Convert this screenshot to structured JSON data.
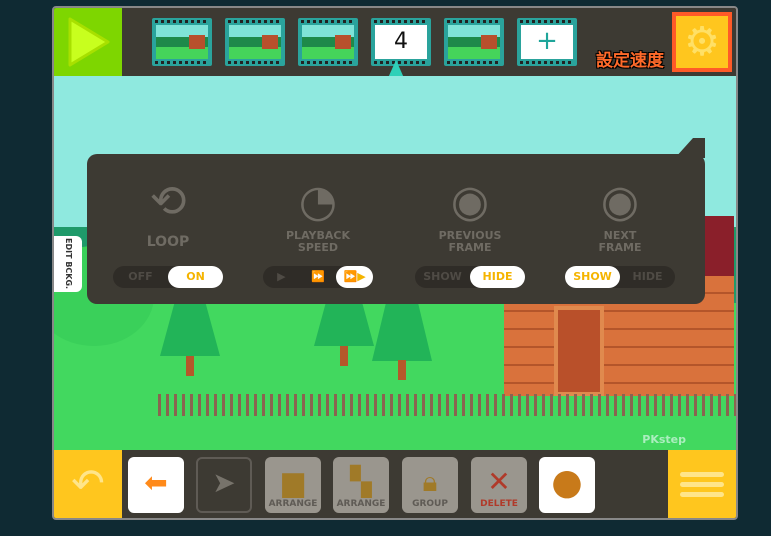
{
  "topbar": {
    "play_icon": "play-icon",
    "frames": [
      {
        "type": "thumb"
      },
      {
        "type": "thumb"
      },
      {
        "type": "thumb"
      },
      {
        "type": "number",
        "label": "4"
      },
      {
        "type": "thumb"
      },
      {
        "type": "add",
        "label": "+"
      }
    ],
    "settings_icon": "gear-icon",
    "annotation": "設定速度"
  },
  "scene": {
    "edit_bg_label": "EDIT BCKG.",
    "watermark": "PKstep"
  },
  "settings": {
    "loop": {
      "label": "LOOP",
      "options": [
        "OFF",
        "ON"
      ],
      "selected": "ON"
    },
    "speed": {
      "label1": "PLAYBACK",
      "label2": "SPEED",
      "options": [
        "slow",
        "medium",
        "fast"
      ],
      "selected": "fast"
    },
    "previous": {
      "label1": "PREVIOUS",
      "label2": "FRAME",
      "options": [
        "SHOW",
        "HIDE"
      ],
      "selected": "HIDE"
    },
    "next": {
      "label1": "NEXT",
      "label2": "FRAME",
      "options": [
        "SHOW",
        "HIDE"
      ],
      "selected": "SHOW"
    }
  },
  "toolbar": {
    "arrange1": "ARRANGE",
    "arrange2": "ARRANGE",
    "group": "GROUP",
    "delete": "DELETE"
  },
  "colors": {
    "accent_yellow": "#ffc61e",
    "play_green": "#7ed600",
    "highlight": "#ff5a28"
  }
}
